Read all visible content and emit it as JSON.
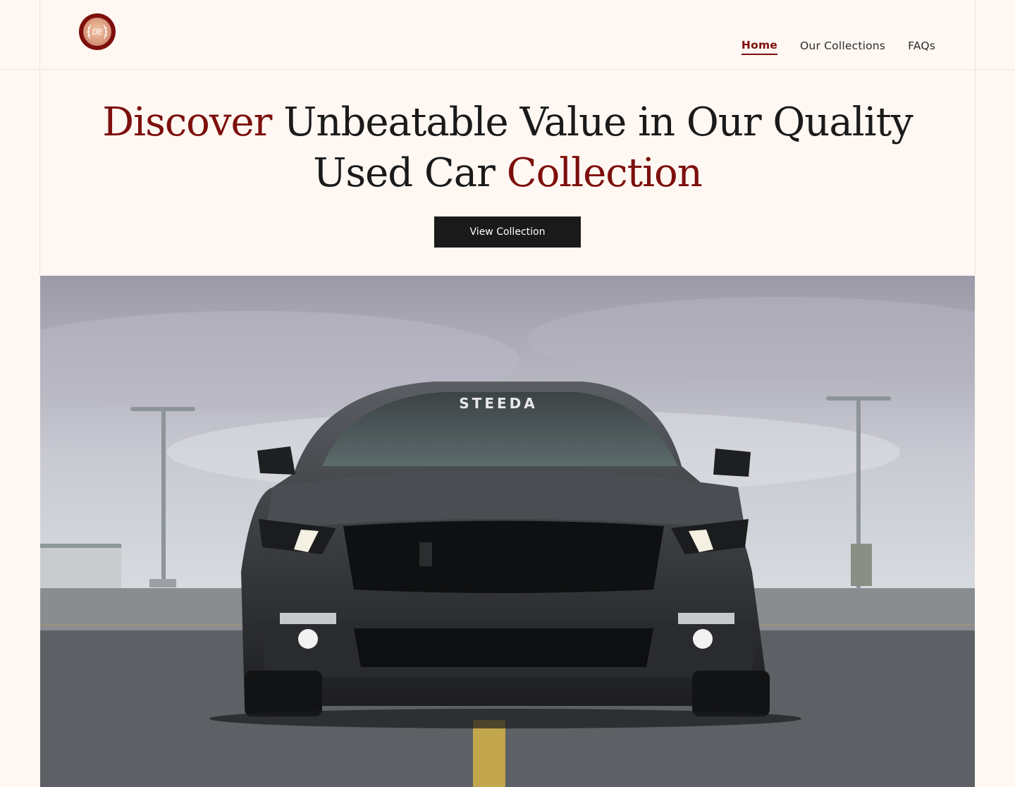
{
  "brand": {
    "logo_text": "DE"
  },
  "nav": {
    "items": [
      {
        "label": "Home",
        "active": true
      },
      {
        "label": "Our Collections",
        "active": false
      },
      {
        "label": "FAQs",
        "active": false
      }
    ]
  },
  "hero": {
    "title_part1": "Discover",
    "title_part2": " Unbeatable Value in Our Quality",
    "title_part3": "Used Car ",
    "title_part4": "Collection",
    "cta_label": "View Collection",
    "windshield_text": "STEEDA"
  },
  "colors": {
    "accent": "#7d0f0c",
    "background": "#fff7f2",
    "button": "#1a1a1a"
  }
}
